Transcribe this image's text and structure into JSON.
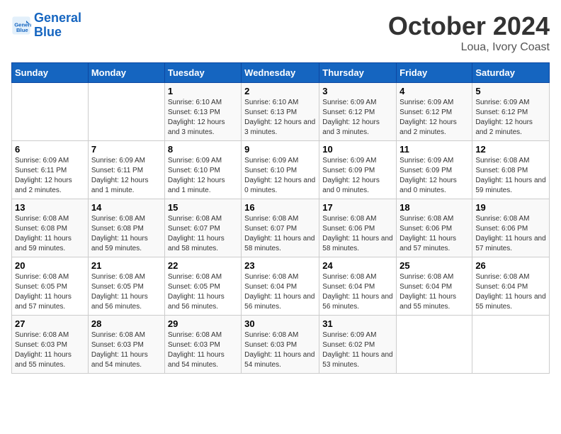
{
  "header": {
    "logo_line1": "General",
    "logo_line2": "Blue",
    "month": "October 2024",
    "location": "Loua, Ivory Coast"
  },
  "weekdays": [
    "Sunday",
    "Monday",
    "Tuesday",
    "Wednesday",
    "Thursday",
    "Friday",
    "Saturday"
  ],
  "weeks": [
    [
      {
        "day": "",
        "info": ""
      },
      {
        "day": "",
        "info": ""
      },
      {
        "day": "1",
        "info": "Sunrise: 6:10 AM\nSunset: 6:13 PM\nDaylight: 12 hours and 3 minutes."
      },
      {
        "day": "2",
        "info": "Sunrise: 6:10 AM\nSunset: 6:13 PM\nDaylight: 12 hours and 3 minutes."
      },
      {
        "day": "3",
        "info": "Sunrise: 6:09 AM\nSunset: 6:12 PM\nDaylight: 12 hours and 3 minutes."
      },
      {
        "day": "4",
        "info": "Sunrise: 6:09 AM\nSunset: 6:12 PM\nDaylight: 12 hours and 2 minutes."
      },
      {
        "day": "5",
        "info": "Sunrise: 6:09 AM\nSunset: 6:12 PM\nDaylight: 12 hours and 2 minutes."
      }
    ],
    [
      {
        "day": "6",
        "info": "Sunrise: 6:09 AM\nSunset: 6:11 PM\nDaylight: 12 hours and 2 minutes."
      },
      {
        "day": "7",
        "info": "Sunrise: 6:09 AM\nSunset: 6:11 PM\nDaylight: 12 hours and 1 minute."
      },
      {
        "day": "8",
        "info": "Sunrise: 6:09 AM\nSunset: 6:10 PM\nDaylight: 12 hours and 1 minute."
      },
      {
        "day": "9",
        "info": "Sunrise: 6:09 AM\nSunset: 6:10 PM\nDaylight: 12 hours and 0 minutes."
      },
      {
        "day": "10",
        "info": "Sunrise: 6:09 AM\nSunset: 6:09 PM\nDaylight: 12 hours and 0 minutes."
      },
      {
        "day": "11",
        "info": "Sunrise: 6:09 AM\nSunset: 6:09 PM\nDaylight: 12 hours and 0 minutes."
      },
      {
        "day": "12",
        "info": "Sunrise: 6:08 AM\nSunset: 6:08 PM\nDaylight: 11 hours and 59 minutes."
      }
    ],
    [
      {
        "day": "13",
        "info": "Sunrise: 6:08 AM\nSunset: 6:08 PM\nDaylight: 11 hours and 59 minutes."
      },
      {
        "day": "14",
        "info": "Sunrise: 6:08 AM\nSunset: 6:08 PM\nDaylight: 11 hours and 59 minutes."
      },
      {
        "day": "15",
        "info": "Sunrise: 6:08 AM\nSunset: 6:07 PM\nDaylight: 11 hours and 58 minutes."
      },
      {
        "day": "16",
        "info": "Sunrise: 6:08 AM\nSunset: 6:07 PM\nDaylight: 11 hours and 58 minutes."
      },
      {
        "day": "17",
        "info": "Sunrise: 6:08 AM\nSunset: 6:06 PM\nDaylight: 11 hours and 58 minutes."
      },
      {
        "day": "18",
        "info": "Sunrise: 6:08 AM\nSunset: 6:06 PM\nDaylight: 11 hours and 57 minutes."
      },
      {
        "day": "19",
        "info": "Sunrise: 6:08 AM\nSunset: 6:06 PM\nDaylight: 11 hours and 57 minutes."
      }
    ],
    [
      {
        "day": "20",
        "info": "Sunrise: 6:08 AM\nSunset: 6:05 PM\nDaylight: 11 hours and 57 minutes."
      },
      {
        "day": "21",
        "info": "Sunrise: 6:08 AM\nSunset: 6:05 PM\nDaylight: 11 hours and 56 minutes."
      },
      {
        "day": "22",
        "info": "Sunrise: 6:08 AM\nSunset: 6:05 PM\nDaylight: 11 hours and 56 minutes."
      },
      {
        "day": "23",
        "info": "Sunrise: 6:08 AM\nSunset: 6:04 PM\nDaylight: 11 hours and 56 minutes."
      },
      {
        "day": "24",
        "info": "Sunrise: 6:08 AM\nSunset: 6:04 PM\nDaylight: 11 hours and 56 minutes."
      },
      {
        "day": "25",
        "info": "Sunrise: 6:08 AM\nSunset: 6:04 PM\nDaylight: 11 hours and 55 minutes."
      },
      {
        "day": "26",
        "info": "Sunrise: 6:08 AM\nSunset: 6:04 PM\nDaylight: 11 hours and 55 minutes."
      }
    ],
    [
      {
        "day": "27",
        "info": "Sunrise: 6:08 AM\nSunset: 6:03 PM\nDaylight: 11 hours and 55 minutes."
      },
      {
        "day": "28",
        "info": "Sunrise: 6:08 AM\nSunset: 6:03 PM\nDaylight: 11 hours and 54 minutes."
      },
      {
        "day": "29",
        "info": "Sunrise: 6:08 AM\nSunset: 6:03 PM\nDaylight: 11 hours and 54 minutes."
      },
      {
        "day": "30",
        "info": "Sunrise: 6:08 AM\nSunset: 6:03 PM\nDaylight: 11 hours and 54 minutes."
      },
      {
        "day": "31",
        "info": "Sunrise: 6:09 AM\nSunset: 6:02 PM\nDaylight: 11 hours and 53 minutes."
      },
      {
        "day": "",
        "info": ""
      },
      {
        "day": "",
        "info": ""
      }
    ]
  ]
}
